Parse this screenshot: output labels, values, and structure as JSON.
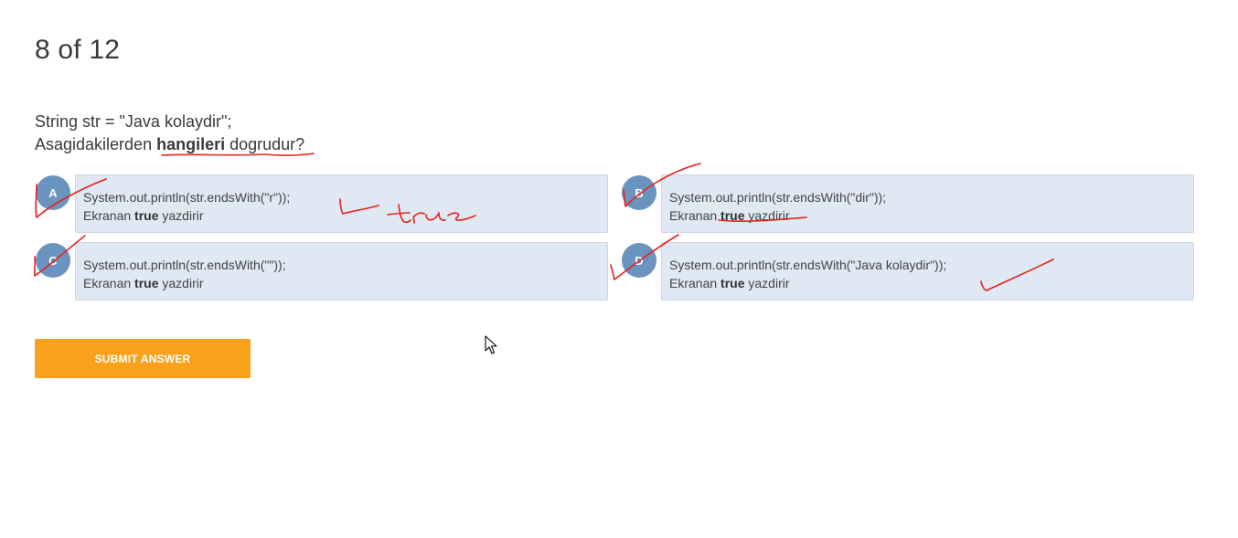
{
  "quiz": {
    "counter": "8 of 12",
    "question_line1": "String str = \"Java kolaydir\";",
    "question_line2_prefix": "Asagidakilerden ",
    "question_line2_bold": "hangileri",
    "question_line2_suffix": " dogrudur?"
  },
  "options": [
    {
      "letter": "A",
      "code": "System.out.println(str.endsWith(\"r\"));",
      "text_prefix": "Ekranan ",
      "text_bold": "true",
      "text_suffix": " yazdirir"
    },
    {
      "letter": "B",
      "code": "System.out.println(str.endsWith(\"dir\"));",
      "text_prefix": "Ekranan ",
      "text_bold": "true",
      "text_suffix": " yazdirir"
    },
    {
      "letter": "C",
      "code": "System.out.println(str.endsWith(\"\"));",
      "text_prefix": "Ekranan ",
      "text_bold": "true",
      "text_suffix": " yazdirir"
    },
    {
      "letter": "D",
      "code": "System.out.println(str.endsWith(\"Java kolaydir\"));",
      "text_prefix": "Ekranan ",
      "text_bold": "true",
      "text_suffix": " yazdirir"
    }
  ],
  "submit_label": "SUBMIT ANSWER",
  "annotation": {
    "handwritten_note": "true",
    "ink_color": "#e5231b"
  },
  "colors": {
    "submit_bg": "#f9a11b",
    "option_bg": "#dfe8f3",
    "badge_bg": "#6b93bf"
  },
  "cursor_icon": "pointer-arrow-icon"
}
